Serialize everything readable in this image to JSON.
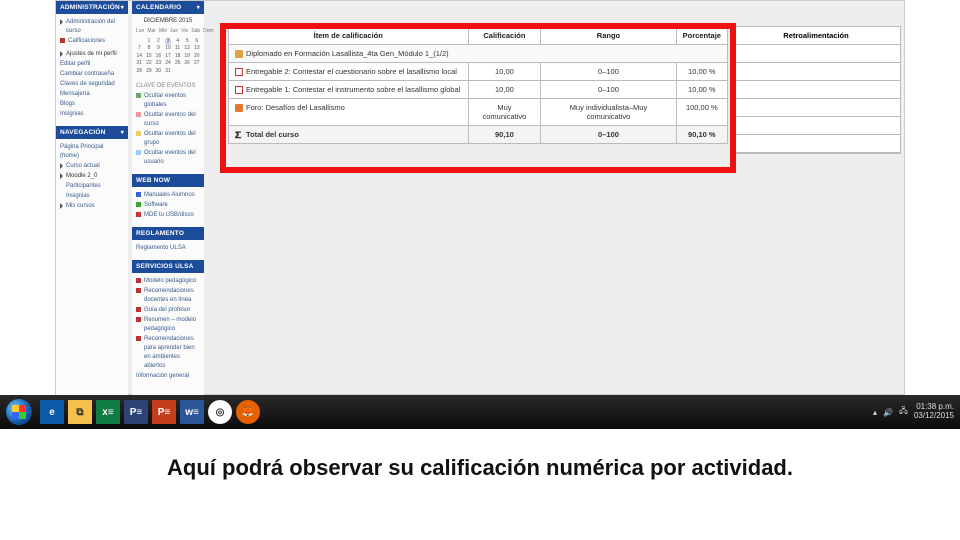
{
  "sidebarA": {
    "block1": {
      "title": "ADMINISTRACIÓN",
      "items": [
        "Administración del curso",
        "Calificaciones"
      ]
    },
    "block2": {
      "title": "—",
      "sub": "Ajustes de mi perfil",
      "items": [
        "Editar perfil",
        "Cambiar contraseña",
        "Claves de seguridad",
        "Mensajería",
        "Blogs",
        "Insignias"
      ]
    },
    "block3": {
      "title": "NAVEGACIÓN",
      "items": [
        "Página Principal (home)",
        "Curso actual",
        "Moodle 2_0",
        "Participantes",
        "Insignias",
        "Mis cursos"
      ]
    }
  },
  "sidebarB": {
    "calendar": {
      "title": "CALENDARIO",
      "month": "DICIEMBRE 2015",
      "days": [
        "Lun",
        "Mar",
        "Mié",
        "Jue",
        "Vie",
        "Sáb",
        "Dom"
      ],
      "weeks": [
        [
          "",
          "1",
          "2",
          "3",
          "4",
          "5",
          "6"
        ],
        [
          "7",
          "8",
          "9",
          "10",
          "11",
          "12",
          "13"
        ],
        [
          "14",
          "15",
          "16",
          "17",
          "18",
          "19",
          "20"
        ],
        [
          "21",
          "22",
          "23",
          "24",
          "25",
          "26",
          "27"
        ],
        [
          "28",
          "29",
          "30",
          "31",
          "",
          "",
          ""
        ]
      ],
      "clave": "CLAVE DE EVENTOS",
      "legend": [
        "Ocultar eventos globales",
        "Ocultar eventos del curso",
        "Ocultar eventos del grupo",
        "Ocultar eventos del usuario"
      ]
    },
    "webnow": {
      "title": "WEB NOW",
      "items": [
        "Manuales Alumnos",
        "Software",
        "MDE tu USB/disco"
      ]
    },
    "regl": {
      "title": "REGLAMENTO",
      "items": [
        "Reglamento ULSA"
      ]
    },
    "serv": {
      "title": "SERVICIOS ULSA",
      "items": [
        "Modelo pedagógico",
        "Recomendaciones docentes en línea",
        "Guía del profesor",
        "Resumen – modelo pedagógico",
        "Recomendaciones para aprender bien en ambientes abiertos",
        "Información general"
      ]
    }
  },
  "grades": {
    "headers": [
      "Ítem de calificación",
      "Calificación",
      "Rango",
      "Porcentaje",
      "Retroalimentación"
    ],
    "courseRow": "Diplomado en Formación Lasallista_4ta Gen_Módulo 1_(1/2)",
    "rows": [
      {
        "item": "Entregable 2: Contestar el cuestionario sobre el lasallismo local",
        "cal": "10,00",
        "rango": "0–100",
        "pct": "10,00 %"
      },
      {
        "item": "Entregable 1: Contestar el instrumento sobre el lasallismo global",
        "cal": "10,00",
        "rango": "0–100",
        "pct": "10,00 %"
      },
      {
        "item": "Foro: Desafíos del Lasallismo",
        "cal": "Muy comunicativo",
        "rango": "Muy individualista–Muy comunicativo",
        "pct": "100,00 %"
      }
    ],
    "total": {
      "label": "Total del curso",
      "cal": "90,10",
      "rango": "0–100",
      "pct": "90,10 %"
    }
  },
  "taskbar": {
    "icons": [
      "ie",
      "fx",
      "xl",
      "pb",
      "pp",
      "wd",
      "ch",
      "ff"
    ],
    "labels": {
      "ie": "e",
      "fx": "⧉",
      "xl": "x≡",
      "pb": "P≡",
      "pp": "P≡",
      "wd": "w≡",
      "ch": "◎",
      "ff": "🦊"
    },
    "time": "01:38 p.m.",
    "date": "03/12/2015"
  },
  "caption": "Aquí podrá observar su calificación numérica por actividad."
}
